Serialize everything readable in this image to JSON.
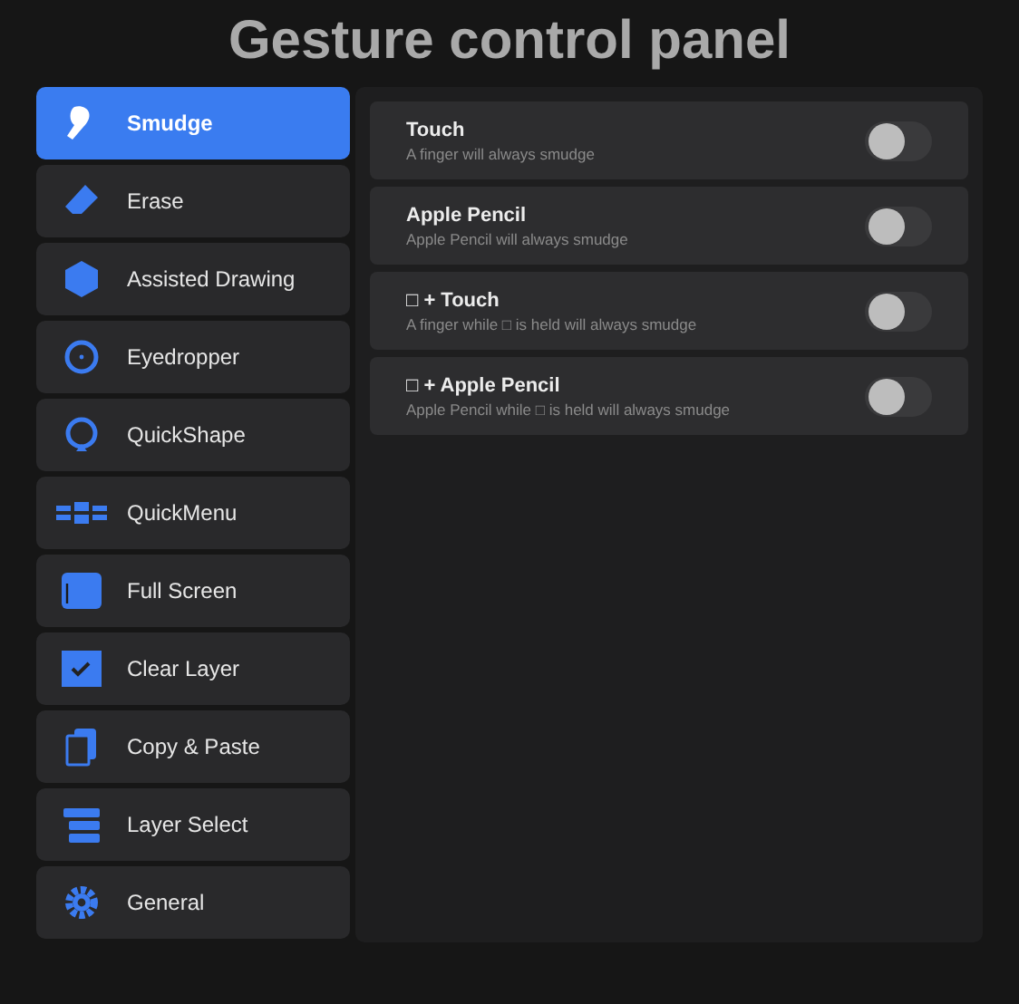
{
  "title": "Gesture control panel",
  "sidebar": {
    "items": [
      {
        "label": "Smudge",
        "selected": true
      },
      {
        "label": "Erase",
        "selected": false
      },
      {
        "label": "Assisted Drawing",
        "selected": false
      },
      {
        "label": "Eyedropper",
        "selected": false
      },
      {
        "label": "QuickShape",
        "selected": false
      },
      {
        "label": "QuickMenu",
        "selected": false
      },
      {
        "label": "Full Screen",
        "selected": false
      },
      {
        "label": "Clear Layer",
        "selected": false
      },
      {
        "label": "Copy & Paste",
        "selected": false
      },
      {
        "label": "Layer Select",
        "selected": false
      },
      {
        "label": "General",
        "selected": false
      }
    ]
  },
  "settings": [
    {
      "title": "Touch",
      "description": "A finger will always smudge",
      "on": false
    },
    {
      "title": "Apple Pencil",
      "description": "Apple Pencil will always smudge",
      "on": false
    },
    {
      "title": "□ + Touch",
      "description": "A finger while □ is held will always smudge",
      "on": false
    },
    {
      "title": "□ + Apple Pencil",
      "description": "Apple Pencil while □ is held will always smudge",
      "on": false
    }
  ]
}
